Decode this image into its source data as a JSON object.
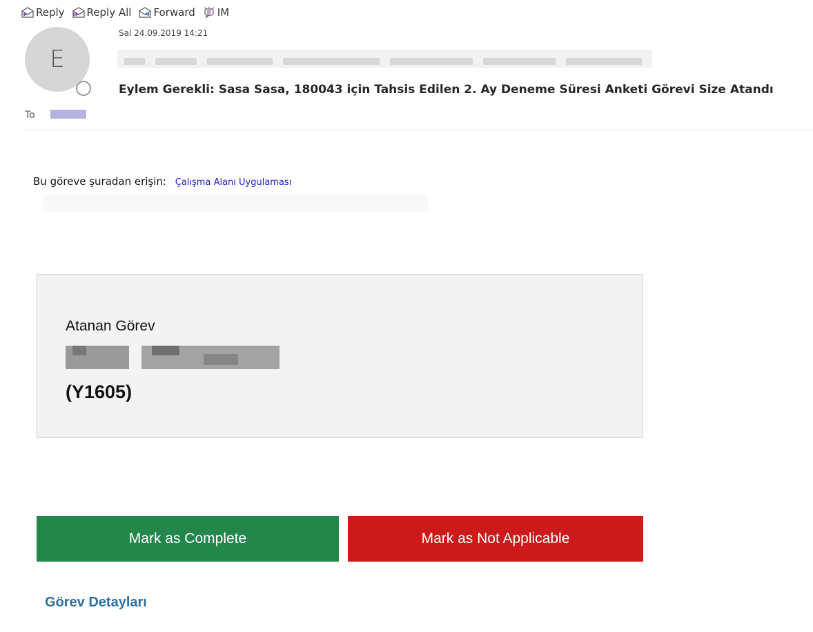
{
  "toolbar": {
    "reply": "Reply",
    "reply_all": "Reply All",
    "forward": "Forward",
    "im": "IM"
  },
  "header": {
    "avatar_initial": "E",
    "date": "Sal 24.09.2019 14:21",
    "subject": "Eylem Gerekli: Sasa Sasa, 180043 için Tahsis Edilen 2. Ay Deneme Süresi Anketi Görevi Size Atandı",
    "to_label": "To"
  },
  "body": {
    "access_text": "Bu göreve şuradan erişin:",
    "access_link": "Çalışma Alanı Uygulaması",
    "card": {
      "title": "Atanan Görev",
      "code": "(Y1605)"
    },
    "buttons": {
      "complete": "Mark as Complete",
      "not_applicable": "Mark as Not Applicable"
    },
    "details_link": "Görev Detayları"
  },
  "colors": {
    "complete_button": "#23874c",
    "not_applicable_button": "#cc1a1a",
    "link": "#1a1ad6",
    "details_link": "#2e6f9e"
  }
}
